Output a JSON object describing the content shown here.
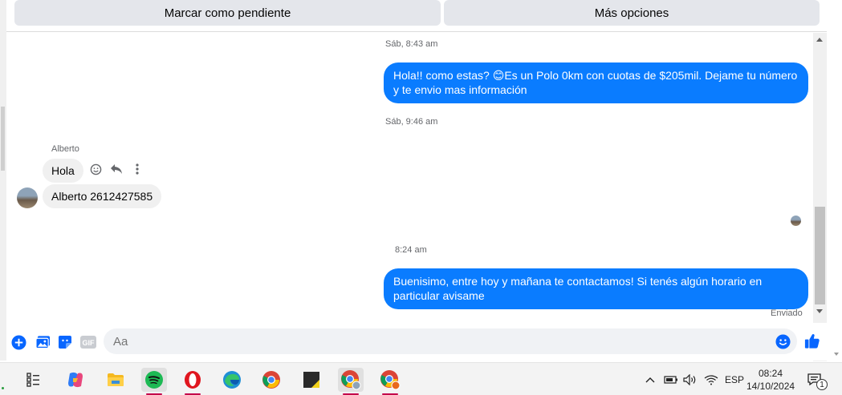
{
  "topbar": {
    "mark_pending": "Marcar como pendiente",
    "more_options": "Más opciones"
  },
  "conversation": {
    "timestamp_1": "Sáb, 8:43 am",
    "message_out_1": "Hola!! como estas? 😊Es un Polo 0km con cuotas de $205mil. Dejame tu número y te envio mas información",
    "timestamp_2": "Sáb, 9:46 am",
    "sender_name": "Alberto",
    "message_in_1": "Hola",
    "message_in_2": "Alberto 2612427585",
    "timestamp_3": "8:24 am",
    "message_out_2": "Buenisimo, entre hoy y mañana te contactamos! Si tenés algún horario en particular avisame",
    "delivery_status": "Enviado"
  },
  "composer": {
    "placeholder": "Aa"
  },
  "taskbar": {
    "language": "ESP",
    "time": "08:24",
    "date": "14/10/2024",
    "notification_count": "1"
  },
  "colors": {
    "outgoing_bubble": "#0a7cff",
    "incoming_bubble": "#f0f0f0",
    "accent": "#0866ff"
  }
}
